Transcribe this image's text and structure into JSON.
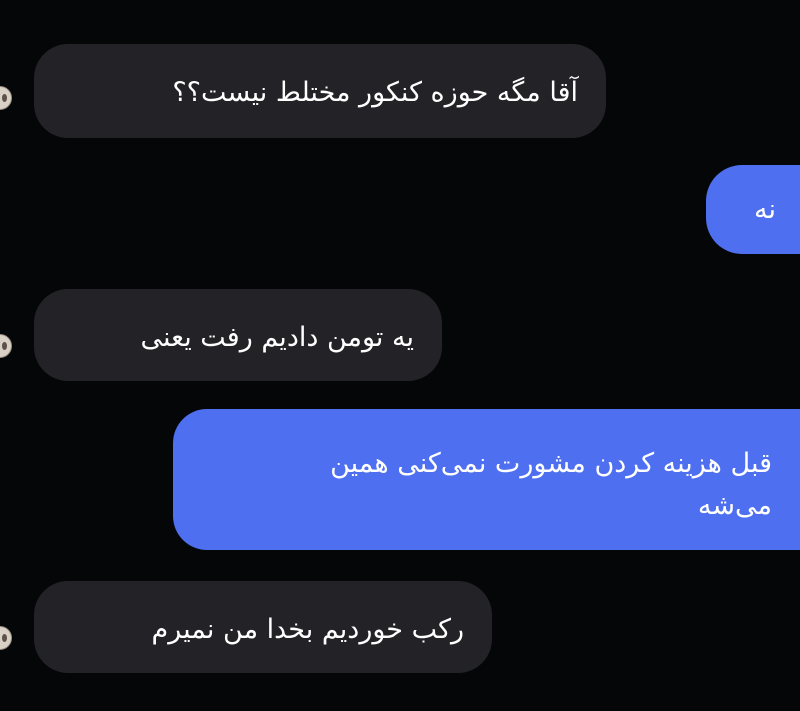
{
  "chat": {
    "messages": [
      {
        "from": "incoming",
        "text": "آقا مگه حوزه کنکور مختلط نیست؟؟"
      },
      {
        "from": "outgoing",
        "text": "نه"
      },
      {
        "from": "incoming",
        "text": "یه تومن دادیم رفت یعنی"
      },
      {
        "from": "outgoing",
        "text": "قبل هزینه کردن مشورت نمی‌کنی همین\nمی‌شه"
      },
      {
        "from": "incoming",
        "text": "رکب خوردیم بخدا من نمیرم"
      }
    ]
  },
  "colors": {
    "background": "#050608",
    "incoming_bubble": "#232327",
    "outgoing_bubble": "#4e6ff0",
    "text": "#ffffff"
  }
}
